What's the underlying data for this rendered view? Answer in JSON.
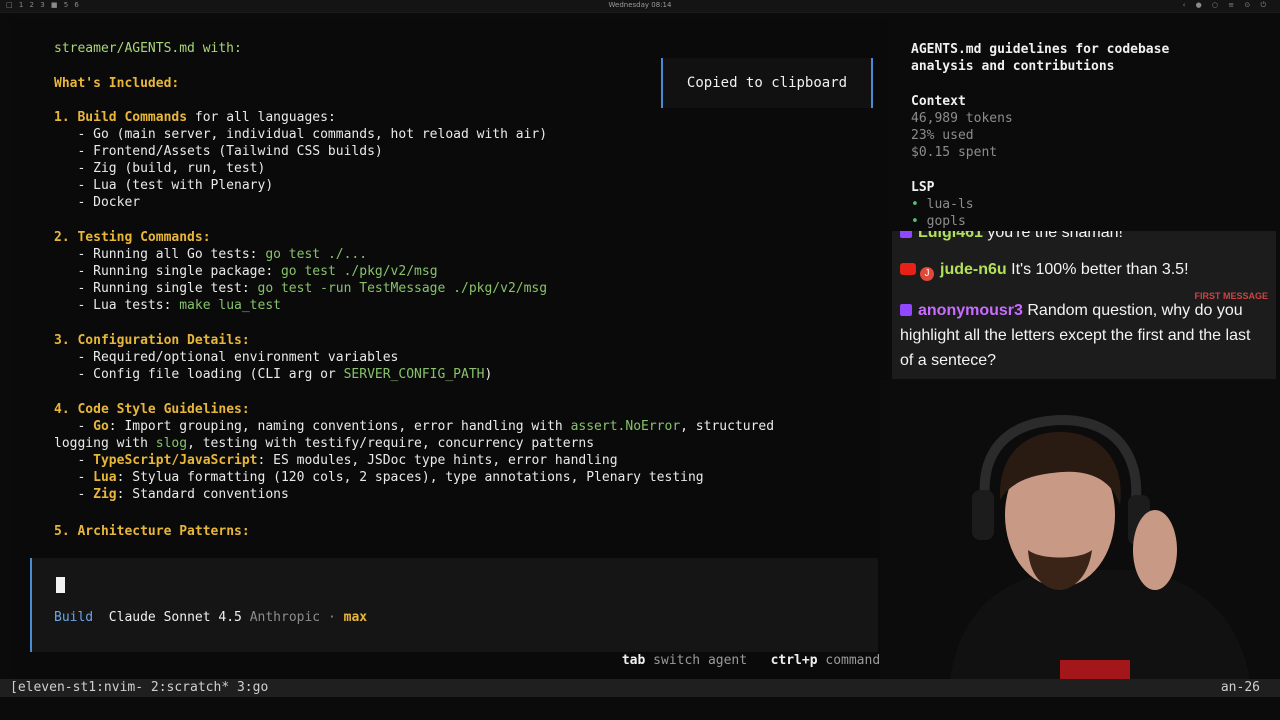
{
  "topbar": {
    "workspaces": "□ 1 2 3 ■ 5 6",
    "clock": "Wednesday 08:14",
    "tray": "‹ ● ○ ≡ ⊙ ⏻"
  },
  "terminal": {
    "lines": {
      "l1": "streamer/AGENTS.md with:",
      "l2": "What's Included:",
      "s1_num": "1. ",
      "s1_title": "Build Commands",
      "s1_rest": " for all languages:",
      "s1_a": "   - Go (main server, individual commands, hot reload with air)",
      "s1_b": "   - Frontend/Assets (Tailwind CSS builds)",
      "s1_c": "   - Zig (build, run, test)",
      "s1_d": "   - Lua (test with Plenary)",
      "s1_e": "   - Docker",
      "s2_num": "2. ",
      "s2_title": "Testing Commands:",
      "s2_a_pre": "   - Running all Go tests: ",
      "s2_a_code": "go test ./...",
      "s2_b_pre": "   - Running single package: ",
      "s2_b_code": "go test ./pkg/v2/msg",
      "s2_c_pre": "   - Running single test: ",
      "s2_c_code": "go test -run TestMessage ./pkg/v2/msg",
      "s2_d_pre": "   - Lua tests: ",
      "s2_d_code": "make lua_test",
      "s3_num": "3. ",
      "s3_title": "Configuration Details:",
      "s3_a": "   - Required/optional environment variables",
      "s3_b_pre": "   - Config file loading (CLI arg or ",
      "s3_b_code": "SERVER_CONFIG_PATH",
      "s3_b_post": ")",
      "s4_num": "4. ",
      "s4_title": "Code Style Guidelines:",
      "s4_a_pre": "   - ",
      "s4_a_lang": "Go",
      "s4_a_text": ": Import grouping, naming conventions, error handling with ",
      "s4_a_code": "assert.NoError",
      "s4_a_post": ", structured",
      "s4_a2_pre": "logging with ",
      "s4_a2_code": "slog",
      "s4_a2_post": ", testing with testify/require, concurrency patterns",
      "s4_b_lang": "TypeScript/JavaScript",
      "s4_b_text": ": ES modules, JSDoc type hints, error handling",
      "s4_c_lang": "Lua",
      "s4_c_text": ": Stylua formatting (120 cols, 2 spaces), type annotations, Plenary testing",
      "s4_d_lang": "Zig",
      "s4_d_text": ": Standard conventions",
      "s5_num": "5. ",
      "s5_title": "Architecture Patterns:"
    },
    "toast": "Copied to clipboard",
    "status": {
      "mode": "Build",
      "model": "Claude Sonnet 4.5",
      "provider": "Anthropic",
      "sep": " · ",
      "effort": "max"
    },
    "hints": {
      "k1": "tab",
      "t1": " switch agent",
      "k2": "ctrl+p",
      "t2": " commands"
    }
  },
  "sidebar": {
    "title": "AGENTS.md guidelines for codebase analysis and contributions",
    "context_label": "Context",
    "tokens": "46,989 tokens",
    "used": "23% used",
    "spent": "$0.15 spent",
    "lsp_label": "LSP",
    "lsp_items": [
      "lua-ls",
      "gopls"
    ]
  },
  "chat": {
    "first_badge": "FIRST MESSAGE",
    "messages": [
      {
        "user": "Luigi461",
        "text": " you're the shaman!",
        "color": "#b3e05a"
      },
      {
        "user": "jude-n6u",
        "text": " It's 100% better than 3.5!",
        "color": "#b3e05a"
      },
      {
        "user": "anonymousr3",
        "text": " Random question, why do you highlight all the letters except the first and the last of a sentece?",
        "color": "#c86cff"
      }
    ],
    "avatar_letter": "J"
  },
  "tmux": {
    "left": "[eleven-st1:nvim- 2:scratch* 3:go",
    "right": "an-26"
  }
}
